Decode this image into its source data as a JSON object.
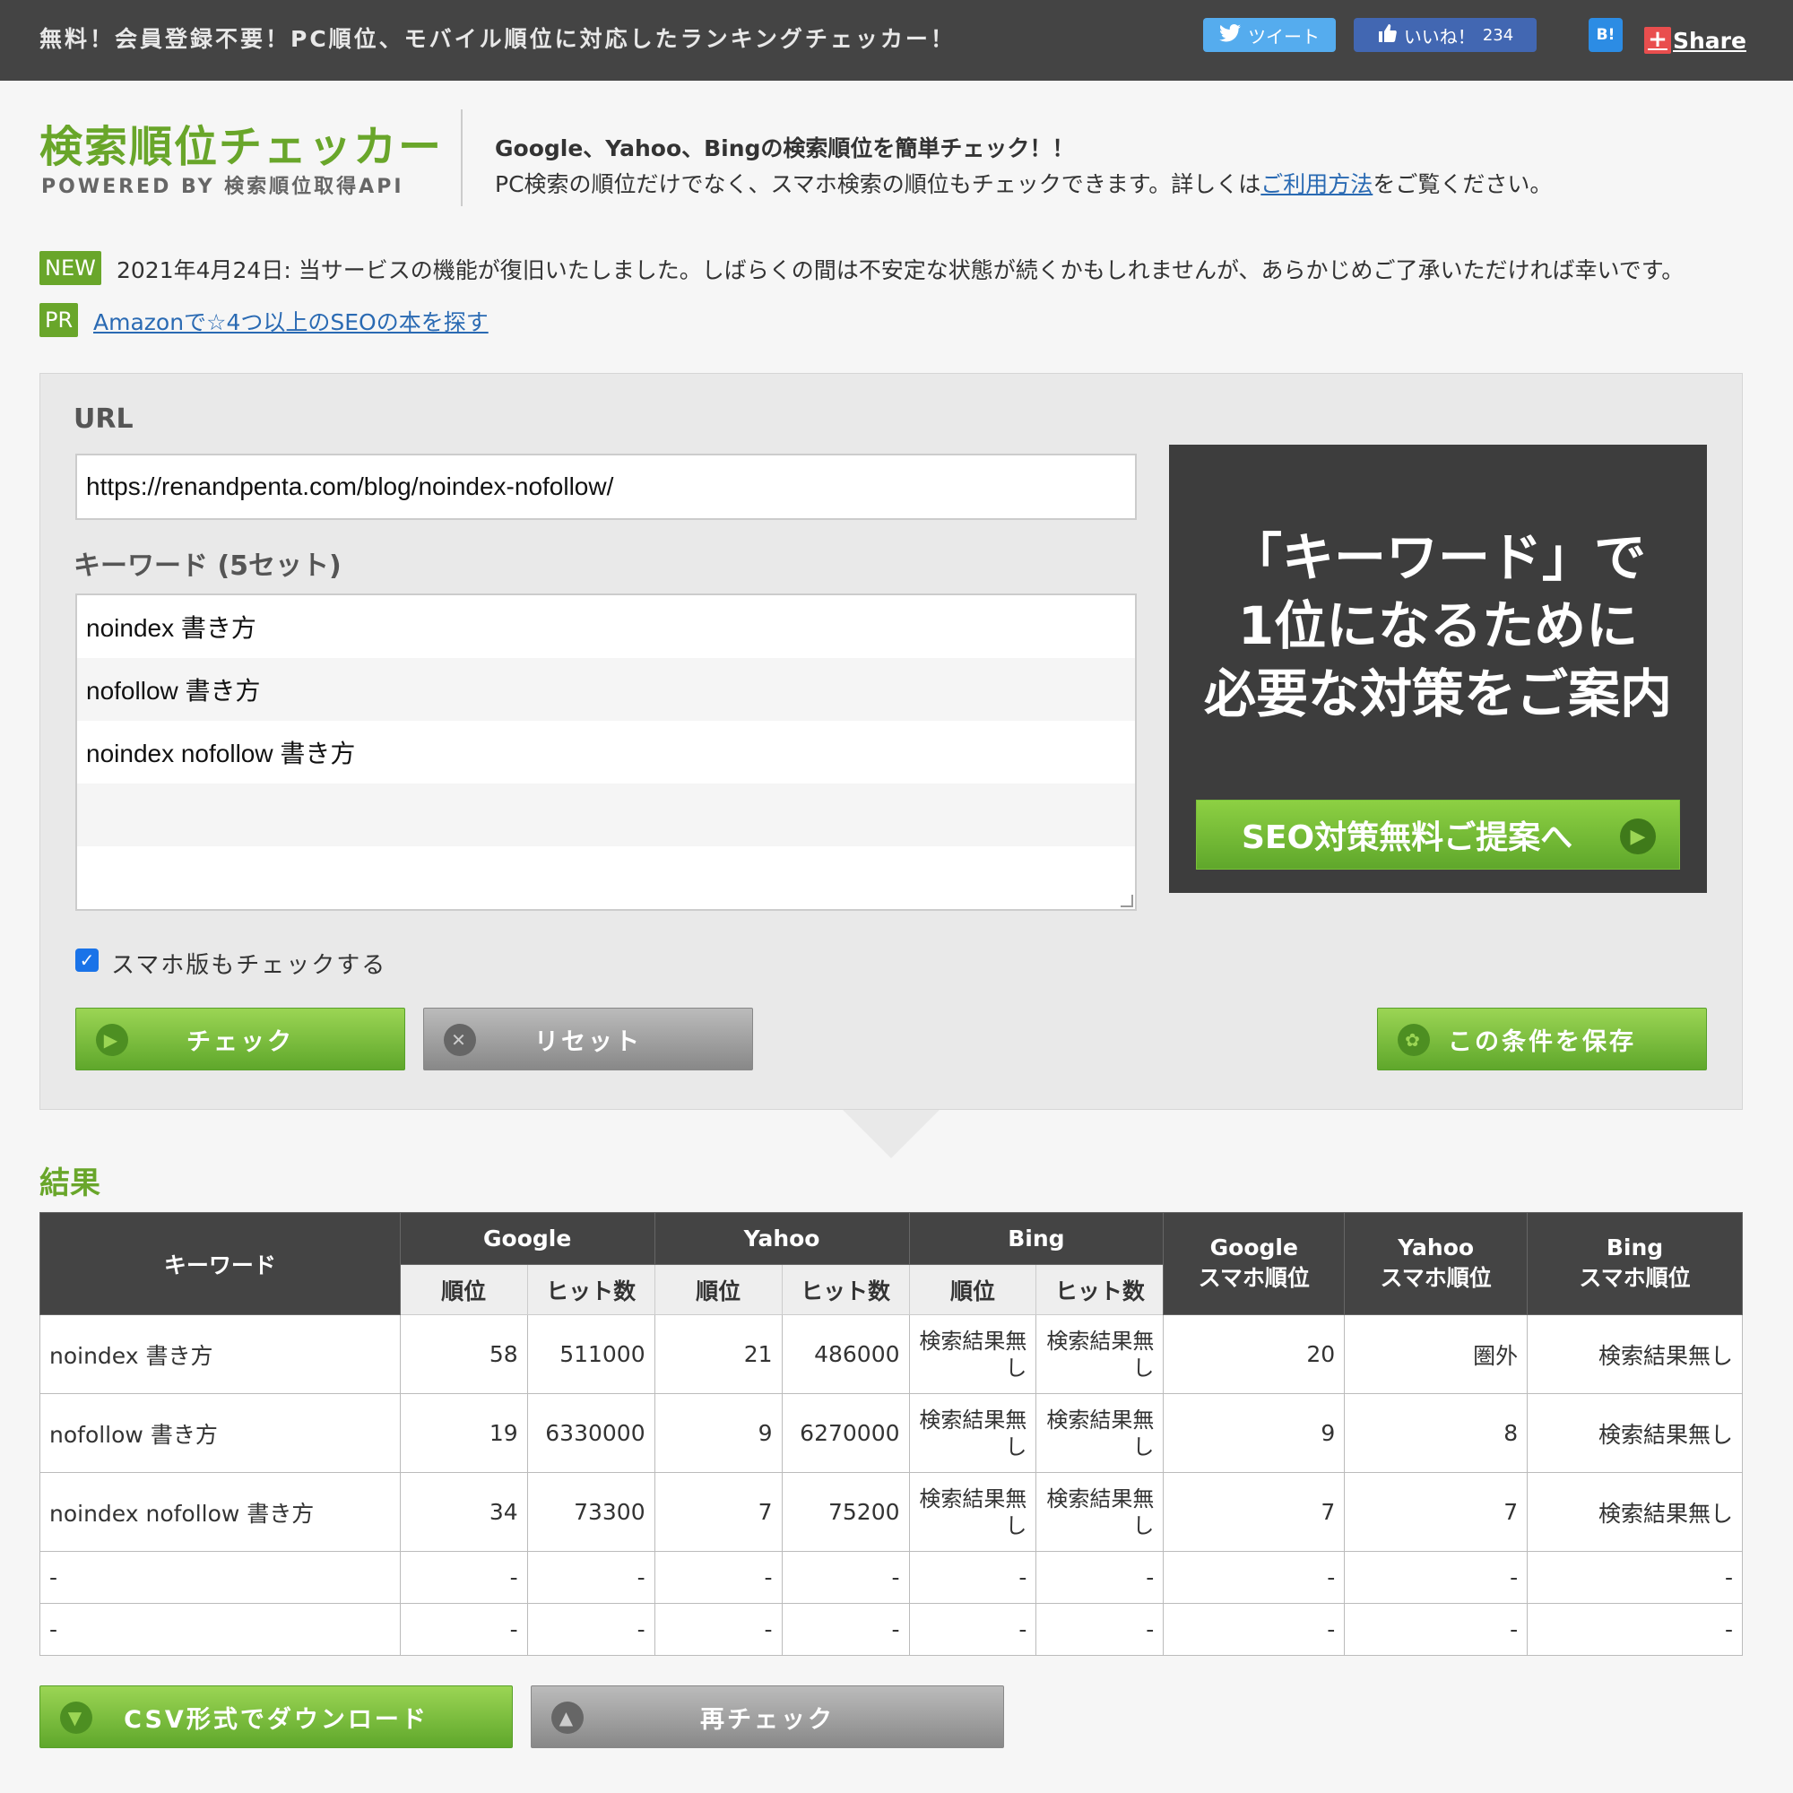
{
  "topbar": {
    "tagline": "無料！会員登録不要！PC順位、モバイル順位に対応したランキングチェッカー！",
    "tweet_label": "ツイート",
    "like_label": "いいね！",
    "like_count": "234",
    "hatena_label": "B!",
    "share_label": "Share"
  },
  "header": {
    "logo_title": "検索順位チェッカー",
    "logo_sub": "POWERED BY 検索順位取得API",
    "intro_line1": "Google、Yahoo、Bingの検索順位を簡単チェック！！",
    "intro_line2_pre": "PC検索の順位だけでなく、スマホ検索の順位もチェックできます。詳しくは",
    "intro_link": "ご利用方法",
    "intro_line2_post": "をご覧ください。"
  },
  "notices": {
    "new_badge": "NEW",
    "new_text": "2021年4月24日: 当サービスの機能が復旧いたしました。しばらくの間は不安定な状態が続くかもしれませんが、あらかじめご了承いただければ幸いです。",
    "pr_badge": "PR",
    "pr_link": "Amazonで☆4つ以上のSEOの本を探す"
  },
  "form": {
    "url_label": "URL",
    "url_value": "https://renandpenta.com/blog/noindex-nofollow/",
    "keyword_label": "キーワード (5セット)",
    "keywords": [
      "noindex 書き方",
      "nofollow 書き方",
      "noindex nofollow 書き方",
      "",
      ""
    ],
    "mobile_check_label": "スマホ版もチェックする",
    "mobile_checked": true,
    "check_button": "チェック",
    "reset_button": "リセット",
    "save_button": "この条件を保存"
  },
  "ad": {
    "line1": "「キーワード」で",
    "line2": "1位になるために",
    "line3": "必要な対策をご案内",
    "cta": "SEO対策無料ご提案へ"
  },
  "results": {
    "title": "結果",
    "headers": {
      "keyword": "キーワード",
      "google": "Google",
      "yahoo": "Yahoo",
      "bing": "Bing",
      "rank": "順位",
      "hits": "ヒット数",
      "google_mobile_1": "Google",
      "google_mobile_2": "スマホ順位",
      "yahoo_mobile_1": "Yahoo",
      "yahoo_mobile_2": "スマホ順位",
      "bing_mobile_1": "Bing",
      "bing_mobile_2": "スマホ順位"
    },
    "rows": [
      {
        "keyword": "noindex 書き方",
        "g_rank": "58",
        "g_hits": "511000",
        "y_rank": "21",
        "y_hits": "486000",
        "b_rank": "検索結果無し",
        "b_hits": "検索結果無し",
        "g_mob": "20",
        "y_mob": "圏外",
        "b_mob": "検索結果無し"
      },
      {
        "keyword": "nofollow 書き方",
        "g_rank": "19",
        "g_hits": "6330000",
        "y_rank": "9",
        "y_hits": "6270000",
        "b_rank": "検索結果無し",
        "b_hits": "検索結果無し",
        "g_mob": "9",
        "y_mob": "8",
        "b_mob": "検索結果無し"
      },
      {
        "keyword": "noindex nofollow 書き方",
        "g_rank": "34",
        "g_hits": "73300",
        "y_rank": "7",
        "y_hits": "75200",
        "b_rank": "検索結果無し",
        "b_hits": "検索結果無し",
        "g_mob": "7",
        "y_mob": "7",
        "b_mob": "検索結果無し"
      },
      {
        "keyword": "-",
        "g_rank": "-",
        "g_hits": "-",
        "y_rank": "-",
        "y_hits": "-",
        "b_rank": "-",
        "b_hits": "-",
        "g_mob": "-",
        "y_mob": "-",
        "b_mob": "-"
      },
      {
        "keyword": "-",
        "g_rank": "-",
        "g_hits": "-",
        "y_rank": "-",
        "y_hits": "-",
        "b_rank": "-",
        "b_hits": "-",
        "g_mob": "-",
        "y_mob": "-",
        "b_mob": "-"
      }
    ],
    "csv_button": "CSV形式でダウンロード",
    "recheck_button": "再チェック"
  }
}
